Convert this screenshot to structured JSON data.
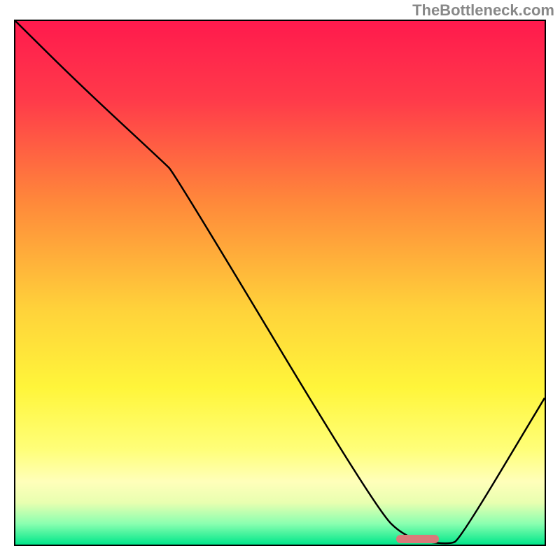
{
  "watermark": "TheBottleneck.com",
  "chart_data": {
    "type": "line",
    "title": "",
    "xlabel": "",
    "ylabel": "",
    "xlim": [
      0,
      100
    ],
    "ylim": [
      0,
      100
    ],
    "gradient_stops": [
      {
        "offset": 0,
        "color": "#ff1a4d"
      },
      {
        "offset": 15,
        "color": "#ff3a4a"
      },
      {
        "offset": 35,
        "color": "#ff8a3a"
      },
      {
        "offset": 55,
        "color": "#ffd23a"
      },
      {
        "offset": 70,
        "color": "#fff53a"
      },
      {
        "offset": 82,
        "color": "#ffff7a"
      },
      {
        "offset": 88,
        "color": "#ffffba"
      },
      {
        "offset": 92,
        "color": "#e8ffb0"
      },
      {
        "offset": 96,
        "color": "#8affb0"
      },
      {
        "offset": 100,
        "color": "#00e68a"
      }
    ],
    "series": [
      {
        "name": "bottleneck-curve",
        "x": [
          0,
          12,
          28,
          30,
          68,
          74,
          82,
          84,
          100
        ],
        "y": [
          100,
          88,
          73,
          71,
          7,
          1,
          0,
          1,
          28
        ]
      }
    ],
    "optimal_marker": {
      "x_start": 72,
      "x_end": 80,
      "y": 0,
      "color": "#d97a7a"
    }
  }
}
